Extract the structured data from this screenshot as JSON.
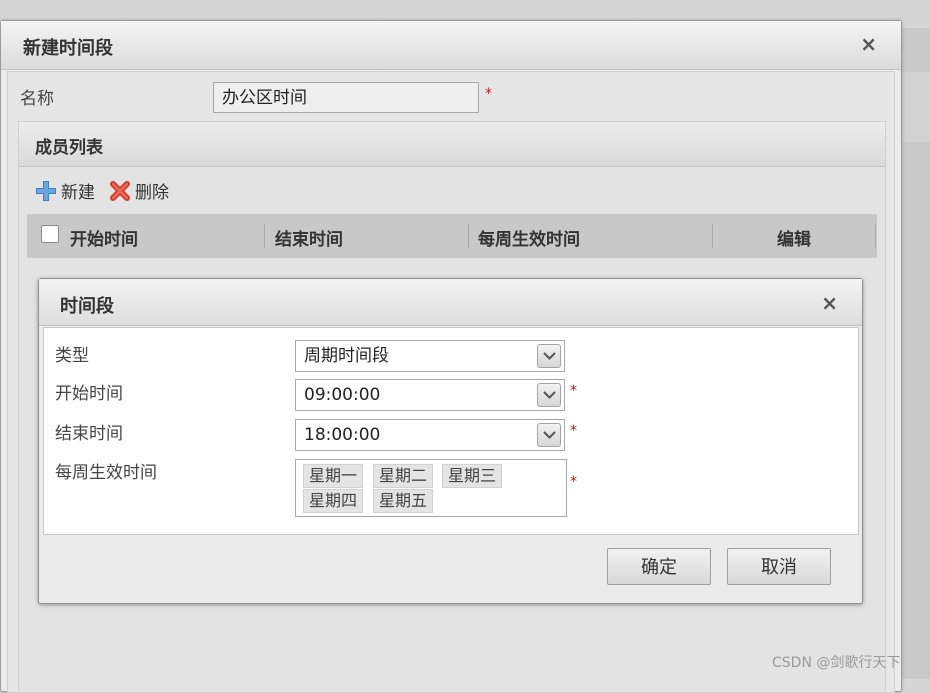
{
  "outer_dialog": {
    "title": "新建时间段",
    "close_symbol": "×",
    "name_label": "名称",
    "name_value": "办公区时间",
    "required_mark": "*",
    "members_panel": {
      "title": "成员列表",
      "toolbar": {
        "new_label": "新建",
        "new_icon": "plus-icon",
        "delete_label": "删除",
        "delete_icon": "x-delete-icon"
      },
      "table_headers": [
        "开始时间",
        "结束时间",
        "每周生效时间",
        "编辑"
      ]
    }
  },
  "inner_dialog": {
    "title": "时间段",
    "close_symbol": "×",
    "fields": {
      "type_label": "类型",
      "type_value": "周期时间段",
      "start_label": "开始时间",
      "start_value": "09:00:00",
      "end_label": "结束时间",
      "end_value": "18:00:00",
      "weekdays_label": "每周生效时间",
      "weekdays": [
        "星期一",
        "星期二",
        "星期三",
        "星期四",
        "星期五"
      ]
    },
    "required_mark": "*",
    "confirm_label": "确定",
    "cancel_label": "取消"
  },
  "watermark": "CSDN @剑歌行天下",
  "colors": {
    "plus_icon": "#3f7fc4",
    "delete_icon": "#d23a2a",
    "required": "#cc1111"
  }
}
